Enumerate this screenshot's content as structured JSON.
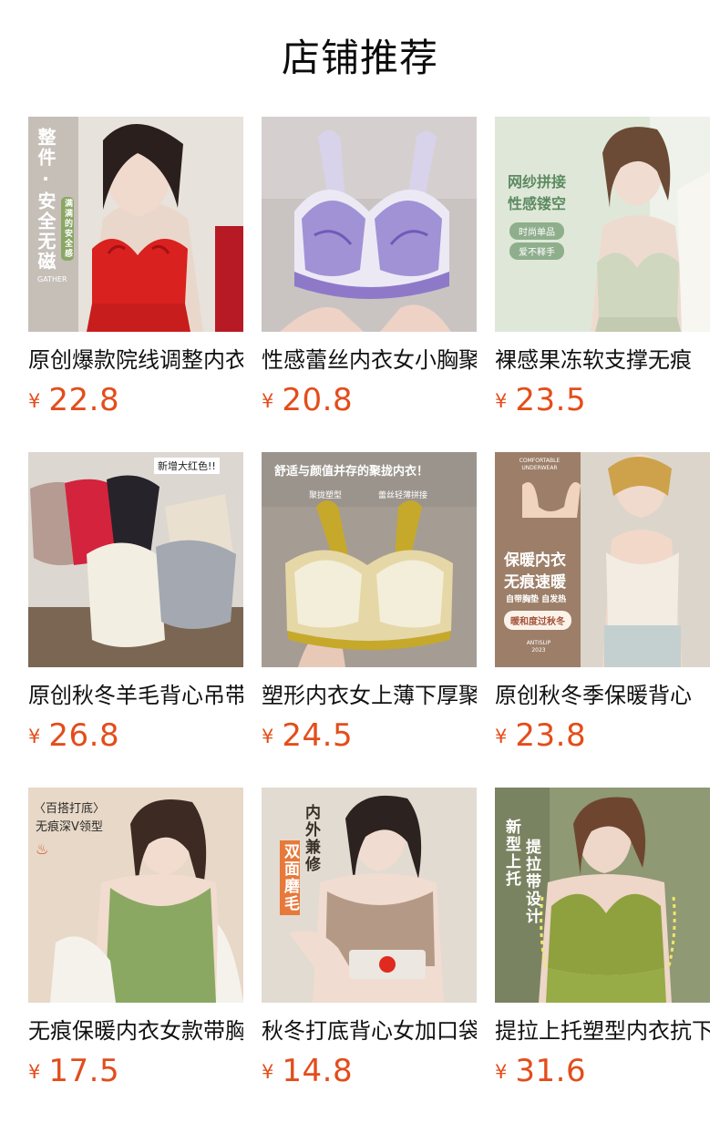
{
  "header": {
    "title": "店铺推荐"
  },
  "products": [
    {
      "name": "原创爆款院线调整内衣",
      "currency": "¥",
      "price": "22.8",
      "image_overlay": {
        "main": "整件·安全无磁",
        "sub": "满满的安全感",
        "brand": "GATHER"
      },
      "colors": {
        "bg": "#e7e2db",
        "accent": "#d9211f"
      }
    },
    {
      "name": "性感蕾丝内衣女小胸聚拢",
      "currency": "¥",
      "price": "20.8",
      "image_overlay": {},
      "colors": {
        "bg": "#c9c4c2",
        "accent": "#8e79c9"
      }
    },
    {
      "name": "裸感果冻软支撑无痕",
      "currency": "¥",
      "price": "23.5",
      "image_overlay": {
        "line1": "网纱拼接",
        "line2": "性感镂空",
        "tag1": "时尚单品",
        "tag2": "爱不释手"
      },
      "colors": {
        "bg": "#dfe8d8",
        "accent": "#cfd7bf"
      }
    },
    {
      "name": "原创秋冬羊毛背心吊带",
      "currency": "¥",
      "price": "26.8",
      "image_overlay": {
        "badge": "新增大红色!!"
      },
      "colors": {
        "bg": "#ddd7d2",
        "accent": "#d4233d"
      }
    },
    {
      "name": "塑形内衣女上薄下厚聚拢",
      "currency": "¥",
      "price": "24.5",
      "image_overlay": {
        "headline": "舒适与颜值并存的聚拢内衣！",
        "feature1": "聚拢塑型",
        "feature2": "蕾丝轻薄拼接"
      },
      "colors": {
        "bg": "#a59d93",
        "accent": "#c6a92b"
      }
    },
    {
      "name": "原创秋冬季保暖背心",
      "currency": "¥",
      "price": "23.8",
      "image_overlay": {
        "top": "COMFORTABLE UNDERWEAR",
        "line1": "保暖内衣",
        "line2": "无痕速暖",
        "line3": "自带胸垫 自发热",
        "pill": "暖和度过秋冬",
        "foot": "ANTISLIP 2023"
      },
      "colors": {
        "bg": "#9d7f69",
        "accent": "#f2ece3"
      }
    },
    {
      "name": "无痕保暖内衣女款带胸垫",
      "currency": "¥",
      "price": "17.5",
      "image_overlay": {
        "line1": "〈百搭打底〉",
        "line2": "无痕深V领型"
      },
      "colors": {
        "bg": "#e7d8c8",
        "accent": "#8aa862"
      }
    },
    {
      "name": "秋冬打底背心女加口袋",
      "currency": "¥",
      "price": "14.8",
      "image_overlay": {
        "line1": "内外兼修",
        "line2": "双面磨毛"
      },
      "colors": {
        "bg": "#e2dbd1",
        "accent": "#b49a86"
      }
    },
    {
      "name": "提拉上托塑型内衣抗下垂",
      "currency": "¥",
      "price": "31.6",
      "image_overlay": {
        "line1": "新型上托",
        "line2": "提拉带设计"
      },
      "colors": {
        "bg": "#8f9973",
        "accent": "#8ea13e"
      }
    }
  ]
}
